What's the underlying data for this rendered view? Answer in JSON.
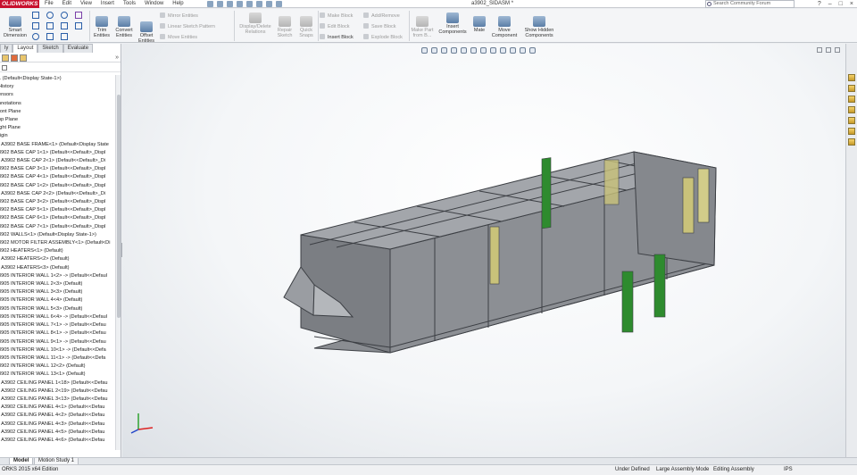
{
  "app": {
    "logo_text": "OLIDWORKS",
    "document_title": "a3902_SIDASM *",
    "search_placeholder": "Search Community Forum",
    "window_controls": [
      "?",
      "–",
      "□",
      "×"
    ]
  },
  "menu": [
    "File",
    "Edit",
    "View",
    "Insert",
    "Tools",
    "Window",
    "Help"
  ],
  "toolbar": {
    "smart_dimension": "Smart Dimension",
    "trim_entities": "Trim Entities",
    "convert_entities": "Convert Entities",
    "offset_entities": "Offset Entities",
    "mirror_entities": "Mirror Entities",
    "linear_sketch_pattern": "Linear Sketch Pattern",
    "move_entities": "Move Entities",
    "display_delete_relations": "Display/Delete Relations",
    "repair_sketch": "Repair Sketch",
    "quick_snaps": "Quick Snaps",
    "make_block": "Make Block",
    "edit_block": "Edit Block",
    "insert_block": "Insert Block",
    "add_remove": "Add/Remove",
    "save_block": "Save Block",
    "explode_block": "Explode Block",
    "make_part_from_block": "Make Part from B...",
    "insert_components": "Insert Components",
    "mate": "Mate",
    "move_component": "Move Component",
    "show_hidden_components": "Show Hidden Components"
  },
  "panel": {
    "tabs": [
      "ly",
      "Layout",
      "Sketch",
      "Evaluate"
    ],
    "expand_label": "»",
    "tree": [
      "1 (Default<Display State-1>)",
      "History",
      "ensors",
      "nnotations",
      "ront Plane",
      "op Plane",
      "ight Plane",
      "rigin",
      ") A3902 BASE FRAME<1> (Default<Display State",
      "3902 BASE CAP 1<1> (Default<<Default>_Displ",
      ") A3902 BASE CAP 2<1> (Default<<Default>_Di",
      "3902 BASE CAP 3<1> (Default<<Default>_Displ",
      "3902 BASE CAP 4<1> (Default<<Default>_Displ",
      "3902 BASE CAP 1<2> (Default<<Default>_Displ",
      ") A3902 BASE CAP 2<2> (Default<<Default>_Di",
      "3902 BASE CAP 3<2> (Default<<Default>_Displ",
      "3902 BASE CAP 5<1> (Default<<Default>_Displ",
      "3902 BASE CAP 6<1> (Default<<Default>_Displ",
      "3902 BASE CAP 7<1> (Default<<Default>_Displ",
      "3902 WALLS<1> (Default<Display State-1>)",
      "3902 MOTOR FILTER ASSEMBLY<1> (Default<Di",
      "3902 HEATERS<1> (Default)",
      ") A3902 HEATERS<2> (Default)",
      ") A3902 HEATERS<3> (Default)",
      "3905 INTERIOR WALL 1<2> -> (Default<<Defaul",
      "3905 INTERIOR WALL 2<3> (Default)",
      "3905 INTERIOR WALL 3<3> (Default)",
      "3905 INTERIOR WALL 4<4> (Default)",
      "3905 INTERIOR WALL 5<3> (Default)",
      "3905 INTERIOR WALL 6<4> -> (Default<<Defaul",
      "3905 INTERIOR WALL 7<1> -> (Default<<Defau",
      "3905 INTERIOR WALL 8<1> -> (Default<<Defau",
      "3905 INTERIOR WALL 9<1> -> (Default<<Defau",
      "3905 INTERIOR WALL 10<1> -> (Default<<Defa",
      "3905 INTERIOR WALL 11<1> -> (Default<<Defa",
      "3902 INTERIOR WALL 12<2> (Default)",
      "3902 INTERIOR WALL 13<1> (Default)",
      ") A3902 CEILING PANEL 1<18> (Default<<Defau",
      ") A3902 CEILING PANEL 2<19> (Default<<Defau",
      ") A3902 CEILING PANEL 3<13> (Default<<Defau",
      ") A3902 CEILING PANEL 4<1> (Default<<Defau",
      ") A3902 CEILING PANEL 4<2> (Default<<Defau",
      ") A3902 CEILING PANEL 4<3> (Default<<Defau",
      ") A3902 CEILING PANEL 4<5> (Default<<Defau",
      ") A3902 CEILING PANEL 4<6> (Default<<Defau"
    ]
  },
  "bottom_tabs": [
    "Model",
    "Motion Study 1"
  ],
  "status": {
    "left": "ORKS 2015 x64 Edition",
    "constraint": "Under Defined",
    "mode": "Large Assembly Mode",
    "editing": "Editing Assembly",
    "units": "IPS"
  },
  "colors": {
    "brand": "#c8102e",
    "viewport_bg": "#f4f6f8",
    "model_metal": "#7d8085",
    "accent_green": "#2e8b2e",
    "accent_yellow": "#c9c27a"
  },
  "icons": [
    "search-icon",
    "triad-icon",
    "home-icon",
    "help-icon"
  ]
}
